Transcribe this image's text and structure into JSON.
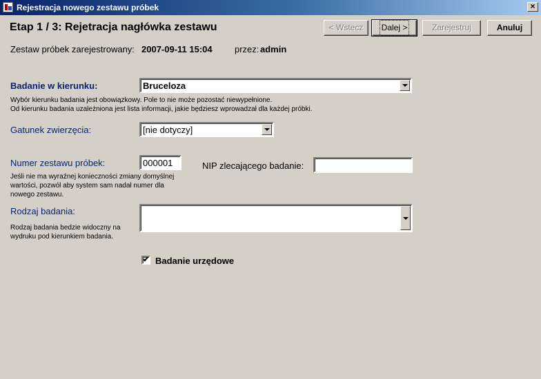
{
  "window": {
    "title": "Rejestracja nowego zestawu próbek",
    "close_glyph": "×"
  },
  "step_title": "Etap 1 / 3: Rejetracja nagłówka zestawu",
  "nav": {
    "back_label": "< Wstecz",
    "next_label": "Dalej >",
    "register_label": "Zarejestruj",
    "cancel_label": "Anuluj"
  },
  "registration": {
    "label": "Zestaw próbek zarejestrowany:",
    "datetime": "2007-09-11 15:04",
    "by_label": "przez:",
    "user": "admin"
  },
  "direction": {
    "label": "Badanie w kierunku:",
    "value": "Bruceloza",
    "hint_line1": "Wybór kierunku badania jest obowiązkowy. Pole to nie może pozostać niewypełnione.",
    "hint_line2": "Od kierunku badania uzależniona jest lista informacji, jakie będziesz wprowadzał dla każdej próbki."
  },
  "species": {
    "label": "Gatunek zwierzęcia:",
    "value": "[nie dotyczy]"
  },
  "set_number": {
    "label": "Numer zestawu próbek:",
    "value": "000001",
    "hint": "Jeśli nie ma wyraźnej konieczności zmiany domyślnej wartości, pozwól aby system sam nadał numer dla nowego zestawu."
  },
  "nip": {
    "label": "NIP zlecającego badanie:",
    "value": ""
  },
  "test_type": {
    "label": "Rodzaj badania:",
    "value": "",
    "hint": "Rodzaj badania bedzie widoczny na wydruku pod kierunkiem badania."
  },
  "official": {
    "label": "Badanie urzędowe",
    "checked": true,
    "check_glyph": "✔"
  },
  "colors": {
    "title_gradient_start": "#0a246a",
    "title_gradient_end": "#a6caf0",
    "label_blue": "#0a246a",
    "dialog_bg": "#d4d0c8"
  }
}
